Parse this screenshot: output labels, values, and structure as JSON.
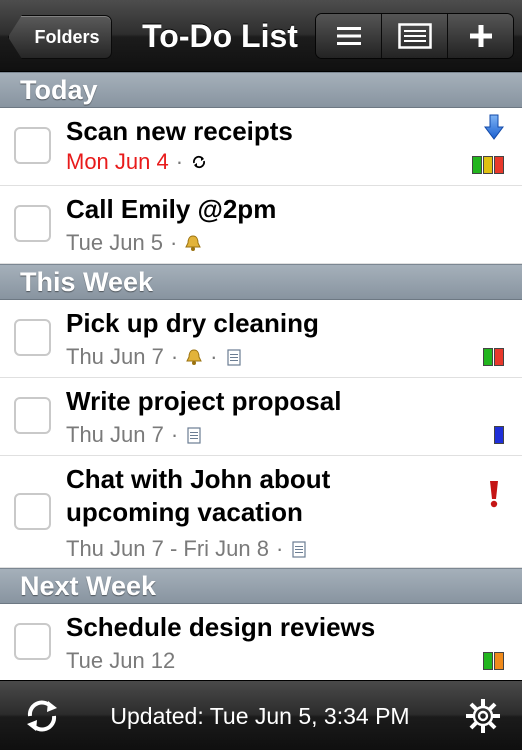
{
  "navbar": {
    "back_label": "Folders",
    "title": "To-Do List",
    "buttons": [
      "list-icon",
      "note-icon",
      "plus-icon"
    ]
  },
  "sections": [
    {
      "title": "Today",
      "tasks": [
        {
          "title": "Scan new receipts",
          "date": "Mon Jun 4",
          "overdue": true,
          "meta_icons": [
            "repeat-icon"
          ],
          "priority": "low-arrow",
          "tags": [
            "#22b51e",
            "#e0c012",
            "#e8382b"
          ]
        },
        {
          "title": "Call Emily @2pm",
          "date": "Tue Jun 5",
          "overdue": false,
          "meta_icons": [
            "alarm-icon"
          ],
          "tags": []
        }
      ]
    },
    {
      "title": "This Week",
      "tasks": [
        {
          "title": "Pick up dry cleaning",
          "date": "Thu Jun 7",
          "overdue": false,
          "meta_icons": [
            "alarm-icon",
            "note-icon"
          ],
          "tags": [
            "#22b51e",
            "#e8382b"
          ]
        },
        {
          "title": "Write project proposal",
          "date": "Thu Jun 7",
          "overdue": false,
          "meta_icons": [
            "note-icon"
          ],
          "tags": [
            "#1f2fd8"
          ]
        },
        {
          "title": "Chat with John about upcoming vacation",
          "date": "Thu Jun 7 - Fri Jun 8",
          "overdue": false,
          "meta_icons": [
            "note-icon"
          ],
          "priority": "high-exclamation",
          "tags": []
        }
      ]
    },
    {
      "title": "Next Week",
      "tasks": [
        {
          "title": "Schedule design reviews",
          "date": "Tue Jun 12",
          "overdue": false,
          "meta_icons": [],
          "tags": [
            "#22b51e",
            "#f08a1b"
          ]
        }
      ]
    }
  ],
  "toolbar": {
    "status": "Updated: Tue Jun 5, 3:34 PM",
    "left_icon": "sync-icon",
    "right_icon": "gear-icon"
  }
}
